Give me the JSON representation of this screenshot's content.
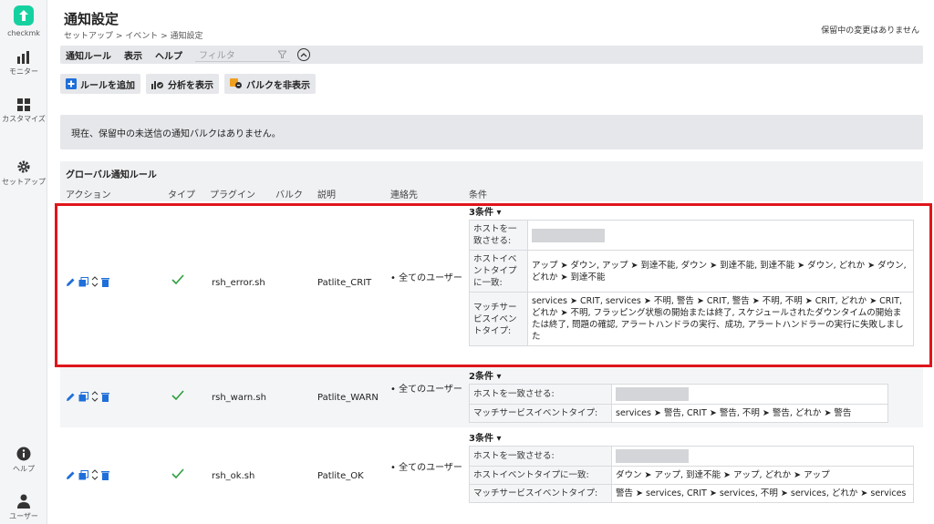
{
  "sidebar": {
    "logo_label": "checkmk",
    "items": [
      {
        "label": "モニター",
        "icon": "bar-chart-icon"
      },
      {
        "label": "カスタマイズ",
        "icon": "grid-icon"
      },
      {
        "label": "セットアップ",
        "icon": "gear-icon"
      }
    ],
    "bottom": [
      {
        "label": "ヘルプ",
        "icon": "info-icon"
      },
      {
        "label": "ユーザー",
        "icon": "user-icon"
      }
    ]
  },
  "header": {
    "title": "通知設定",
    "breadcrumb": "セットアップ > イベント > 通知設定",
    "pending": "保留中の変更はありません"
  },
  "menubar": {
    "items": [
      "通知ルール",
      "表示",
      "ヘルプ"
    ],
    "filter_placeholder": "フィルタ"
  },
  "toolbar": {
    "add_rule": "ルールを追加",
    "show_analysis": "分析を表示",
    "hide_bulk": "バルクを非表示"
  },
  "info_message": "現在、保留中の未送信の通知バルクはありません。",
  "rules": {
    "section_title": "グローバル通知ルール",
    "columns": [
      "アクション",
      "タイプ",
      "プラグイン",
      "バルク",
      "説明",
      "連絡先",
      "条件"
    ],
    "rows": [
      {
        "plugin": "rsh_error.sh",
        "description": "Patlite_CRIT",
        "contacts": "• 全てのユーザー",
        "cond_count": "3条件 ▾",
        "conditions": [
          {
            "key": "ホストを一致させる:",
            "value": ""
          },
          {
            "key": "ホストイベントタイプに一致:",
            "value": "アップ ➤ ダウン, アップ ➤ 到達不能, ダウン ➤ 到達不能, 到達不能 ➤ ダウン, どれか ➤ ダウン, どれか ➤ 到達不能"
          },
          {
            "key": "マッチサービスイベントタイプ:",
            "value": "services ➤ CRIT, services ➤ 不明, 警告 ➤ CRIT, 警告 ➤ 不明, 不明 ➤ CRIT, どれか ➤ CRIT, どれか ➤ 不明, フラッピング状態の開始または終了, スケジュールされたダウンタイムの開始または終了, 問題の確認, アラートハンドラの実行、成功, アラートハンドラーの実行に失敗しました"
          }
        ]
      },
      {
        "plugin": "rsh_warn.sh",
        "description": "Patlite_WARN",
        "contacts": "• 全てのユーザー",
        "cond_count": "2条件 ▾",
        "conditions": [
          {
            "key": "ホストを一致させる:",
            "value": ""
          },
          {
            "key": "マッチサービスイベントタイプ:",
            "value": "services ➤ 警告, CRIT ➤ 警告, 不明 ➤ 警告, どれか ➤ 警告"
          }
        ]
      },
      {
        "plugin": "rsh_ok.sh",
        "description": "Patlite_OK",
        "contacts": "• 全てのユーザー",
        "cond_count": "3条件 ▾",
        "conditions": [
          {
            "key": "ホストを一致させる:",
            "value": ""
          },
          {
            "key": "ホストイベントタイプに一致:",
            "value": "ダウン ➤ アップ, 到達不能 ➤ アップ, どれか ➤ アップ"
          },
          {
            "key": "マッチサービスイベントタイプ:",
            "value": "警告 ➤ services, CRIT ➤ services, 不明 ➤ services, どれか ➤ services"
          }
        ]
      }
    ]
  },
  "colors": {
    "accent": "#15d1a0",
    "highlight": "#e0151b",
    "edit_icon": "#1e6fd9",
    "check": "#2e9e3e"
  }
}
